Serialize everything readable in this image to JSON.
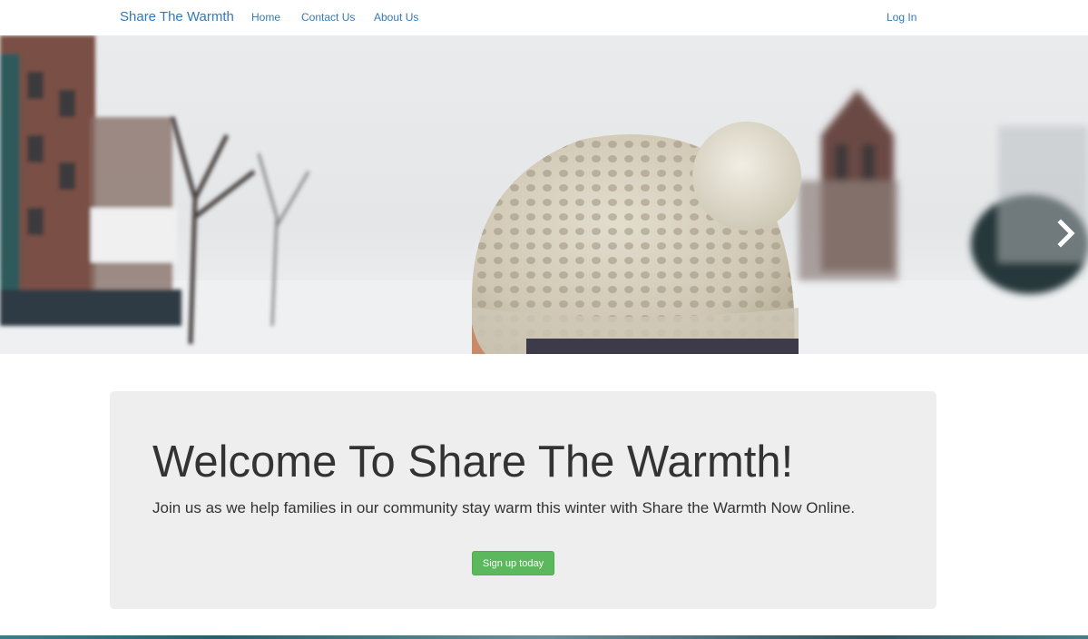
{
  "navbar": {
    "brand": "Share The Warmth",
    "links": [
      {
        "label": "Home"
      },
      {
        "label": "Contact Us"
      },
      {
        "label": "About Us"
      }
    ],
    "login_label": "Log In"
  },
  "carousel": {
    "indicator_count": 5,
    "active_index": 3,
    "next_icon": "chevron-right-icon"
  },
  "jumbotron": {
    "title": "Welcome To Share The Warmth!",
    "lead": "Join us as we help families in our community stay warm this winter with Share the Warmth Now Online.",
    "button_label": "Sign up today"
  },
  "colors": {
    "link": "#337ab7",
    "jumbotron_bg": "#eeeeee",
    "button": "#5cb85c",
    "text": "#333333"
  }
}
